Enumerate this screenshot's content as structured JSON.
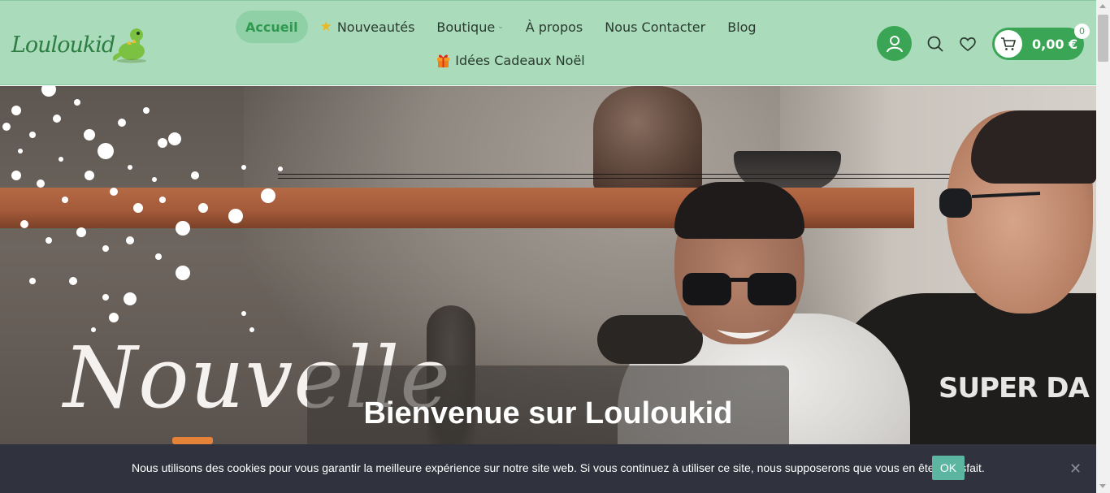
{
  "brand": {
    "logo_text": "Louloukid"
  },
  "nav": {
    "items": [
      {
        "label": "Accueil",
        "active": true
      },
      {
        "label": "Nouveautés",
        "icon": "star-icon"
      },
      {
        "label": "Boutique",
        "has_dropdown": true
      },
      {
        "label": "À propos"
      },
      {
        "label": "Nous Contacter"
      },
      {
        "label": "Blog"
      }
    ],
    "second_row": [
      {
        "label": "Idées Cadeaux Noël",
        "icon": "gift-icon"
      }
    ]
  },
  "header_icons": [
    "user-icon",
    "search-icon",
    "heart-icon"
  ],
  "cart": {
    "total": "0,00 €",
    "count": "0"
  },
  "hero": {
    "script_word": "Nouvelle",
    "welcome": "Bienvenue sur Louloukid",
    "shirt_print": "SUPER DA"
  },
  "cookie": {
    "message": "Nous utilisons des cookies pour vous garantir la meilleure expérience sur notre site web. Si vous continuez à utiliser ce site, nous supposerons que vous en êtes satisfait.",
    "ok_label": "OK",
    "close_glyph": "✕"
  },
  "colors": {
    "header_bg": "#aadcbc",
    "accent": "#3aa655",
    "cookie_bg": "#30333d",
    "cookie_ok": "#5bb5a0"
  }
}
